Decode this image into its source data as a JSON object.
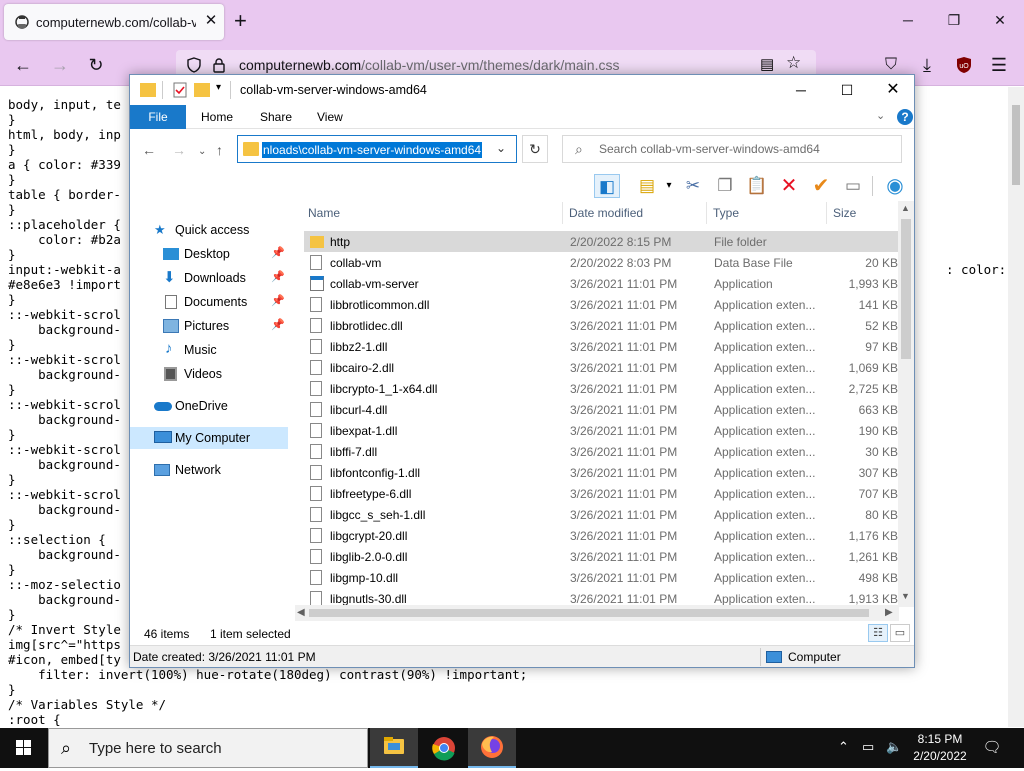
{
  "browser": {
    "tab_title": "computernewb.com/collab-vm",
    "url_host": "computernewb.com",
    "url_path": "/collab-vm/user-vm/themes/dark/main.css"
  },
  "page": {
    "code_lines": [
      "body, input, te",
      "}",
      "html, body, inp",
      "}",
      "a { color: #339",
      "}",
      "table { border-",
      "}",
      "::placeholder {",
      "    color: #b2a",
      "}",
      "input:-webkit-a",
      "#e8e6e3 !import",
      "}",
      "::-webkit-scrol",
      "    background-",
      "}",
      "::-webkit-scrol",
      "    background-",
      "}",
      "::-webkit-scrol",
      "    background-",
      "}",
      "::-webkit-scrol",
      "    background-",
      "}",
      "::-webkit-scrol",
      "    background-",
      "}",
      "::selection {",
      "    background-",
      "}",
      "::-moz-selectio",
      "    background-",
      "}",
      "/* Invert Style",
      "img[src^=\"https",
      "#icon, embed[ty",
      "    filter: invert(100%) hue-rotate(180deg) contrast(90%) !important;",
      "}",
      "/* Variables Style */",
      ":root {"
    ],
    "code_right_fragment": ": color:"
  },
  "explorer": {
    "title": "collab-vm-server-windows-amd64",
    "ribbon_tabs": [
      "File",
      "Home",
      "Share",
      "View"
    ],
    "address_text": "nloads\\collab-vm-server-windows-amd64",
    "search_placeholder": "Search collab-vm-server-windows-amd64",
    "columns": {
      "name": "Name",
      "date": "Date modified",
      "type": "Type",
      "size": "Size"
    },
    "nav": [
      {
        "label": "Quick access",
        "icon": "star-icon"
      },
      {
        "label": "Desktop",
        "icon": "desktop-icon"
      },
      {
        "label": "Downloads",
        "icon": "download-icon"
      },
      {
        "label": "Documents",
        "icon": "document-icon"
      },
      {
        "label": "Pictures",
        "icon": "picture-icon"
      },
      {
        "label": "Music",
        "icon": "music-icon"
      },
      {
        "label": "Videos",
        "icon": "video-icon"
      },
      {
        "label": "OneDrive",
        "icon": "cloud-icon"
      },
      {
        "label": "My Computer",
        "icon": "computer-icon"
      },
      {
        "label": "Network",
        "icon": "network-icon"
      }
    ],
    "files": [
      {
        "name": "http",
        "date": "2/20/2022 8:15 PM",
        "type": "File folder",
        "size": "",
        "kind": "folder"
      },
      {
        "name": "collab-vm",
        "date": "2/20/2022 8:03 PM",
        "type": "Data Base File",
        "size": "20 KB",
        "kind": "file"
      },
      {
        "name": "collab-vm-server",
        "date": "3/26/2021 11:01 PM",
        "type": "Application",
        "size": "1,993 KB",
        "kind": "app"
      },
      {
        "name": "libbrotlicommon.dll",
        "date": "3/26/2021 11:01 PM",
        "type": "Application exten...",
        "size": "141 KB",
        "kind": "dll"
      },
      {
        "name": "libbrotlidec.dll",
        "date": "3/26/2021 11:01 PM",
        "type": "Application exten...",
        "size": "52 KB",
        "kind": "dll"
      },
      {
        "name": "libbz2-1.dll",
        "date": "3/26/2021 11:01 PM",
        "type": "Application exten...",
        "size": "97 KB",
        "kind": "dll"
      },
      {
        "name": "libcairo-2.dll",
        "date": "3/26/2021 11:01 PM",
        "type": "Application exten...",
        "size": "1,069 KB",
        "kind": "dll"
      },
      {
        "name": "libcrypto-1_1-x64.dll",
        "date": "3/26/2021 11:01 PM",
        "type": "Application exten...",
        "size": "2,725 KB",
        "kind": "dll"
      },
      {
        "name": "libcurl-4.dll",
        "date": "3/26/2021 11:01 PM",
        "type": "Application exten...",
        "size": "663 KB",
        "kind": "dll"
      },
      {
        "name": "libexpat-1.dll",
        "date": "3/26/2021 11:01 PM",
        "type": "Application exten...",
        "size": "190 KB",
        "kind": "dll"
      },
      {
        "name": "libffi-7.dll",
        "date": "3/26/2021 11:01 PM",
        "type": "Application exten...",
        "size": "30 KB",
        "kind": "dll"
      },
      {
        "name": "libfontconfig-1.dll",
        "date": "3/26/2021 11:01 PM",
        "type": "Application exten...",
        "size": "307 KB",
        "kind": "dll"
      },
      {
        "name": "libfreetype-6.dll",
        "date": "3/26/2021 11:01 PM",
        "type": "Application exten...",
        "size": "707 KB",
        "kind": "dll"
      },
      {
        "name": "libgcc_s_seh-1.dll",
        "date": "3/26/2021 11:01 PM",
        "type": "Application exten...",
        "size": "80 KB",
        "kind": "dll"
      },
      {
        "name": "libgcrypt-20.dll",
        "date": "3/26/2021 11:01 PM",
        "type": "Application exten...",
        "size": "1,176 KB",
        "kind": "dll"
      },
      {
        "name": "libglib-2.0-0.dll",
        "date": "3/26/2021 11:01 PM",
        "type": "Application exten...",
        "size": "1,261 KB",
        "kind": "dll"
      },
      {
        "name": "libgmp-10.dll",
        "date": "3/26/2021 11:01 PM",
        "type": "Application exten...",
        "size": "498 KB",
        "kind": "dll"
      },
      {
        "name": "libgnutls-30.dll",
        "date": "3/26/2021 11:01 PM",
        "type": "Application exten...",
        "size": "1,913 KB",
        "kind": "dll"
      }
    ],
    "selected_index": 0,
    "status": {
      "item_count": "46 items",
      "selection": "1 item selected"
    },
    "info": {
      "created": "Date created: 3/26/2021 11:01 PM",
      "location": "Computer"
    }
  },
  "taskbar": {
    "search_placeholder": "Type here to search",
    "time": "8:15 PM",
    "date": "2/20/2022"
  },
  "colors": {
    "ff_chrome": "#e9c8f0",
    "accent_blue": "#1979ca",
    "selection_blue": "#0078d7",
    "folder_yellow": "#f5c342",
    "delete_red": "#e81123",
    "check_orange": "#e8891a"
  }
}
